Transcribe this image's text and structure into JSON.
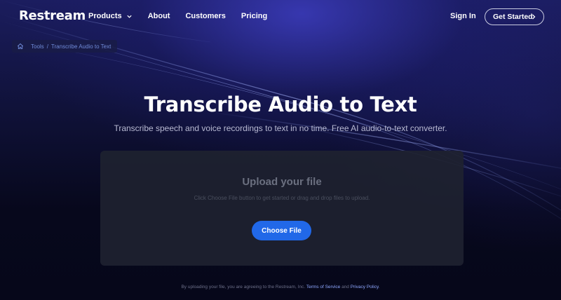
{
  "header": {
    "logo": "Restream",
    "nav": [
      {
        "label": "Products",
        "has_dropdown": true
      },
      {
        "label": "About"
      },
      {
        "label": "Customers"
      },
      {
        "label": "Pricing"
      }
    ],
    "sign_in": "Sign In",
    "get_started": "Get Started"
  },
  "breadcrumb": {
    "items": [
      "Tools",
      "Transcribe Audio to Text"
    ],
    "separator": "/"
  },
  "hero": {
    "title": "Transcribe Audio to Text",
    "subtitle": "Transcribe speech and voice recordings to text in no time. Free AI audio-to-text converter."
  },
  "upload": {
    "title": "Upload your file",
    "hint": "Click Choose File button to get started or drag and drop files to upload.",
    "button": "Choose File"
  },
  "consent": {
    "prefix": "By uploading your file, you are agreeing to the Restream, Inc.",
    "terms": "Terms of Service",
    "and": "and",
    "privacy": "Privacy Policy",
    "suffix": "."
  },
  "colors": {
    "accent": "#2168e8",
    "background": "#07081c",
    "link": "#8fa8ff"
  }
}
